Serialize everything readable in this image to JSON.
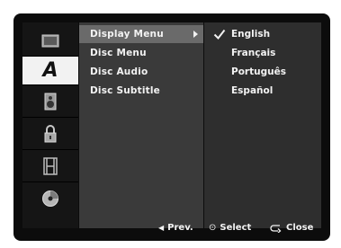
{
  "sidebar": {
    "icons": [
      {
        "name": "tv-icon"
      },
      {
        "name": "language-icon",
        "glyph": "A"
      },
      {
        "name": "speaker-icon"
      },
      {
        "name": "lock-icon"
      },
      {
        "name": "film-icon"
      },
      {
        "name": "disc-icon"
      }
    ],
    "active_index": 1
  },
  "menu": {
    "items": [
      "Display Menu",
      "Disc Menu",
      "Disc Audio",
      "Disc Subtitle"
    ],
    "selected_index": 0
  },
  "options": {
    "items": [
      "English",
      "Français",
      "Português",
      "Español"
    ],
    "checked_index": 0
  },
  "footer": {
    "prev_label": "Prev.",
    "select_label": "Select",
    "close_label": "Close",
    "prev_glyph": "◀",
    "select_glyph": "⊙"
  },
  "colors": {
    "screen_bg": "#0c0c0c",
    "menu_bg": "#3a3a3a",
    "selected_bg": "#6a6a6a",
    "active_icon_bg": "#f2f2f2",
    "text": "#f2f2f2"
  }
}
